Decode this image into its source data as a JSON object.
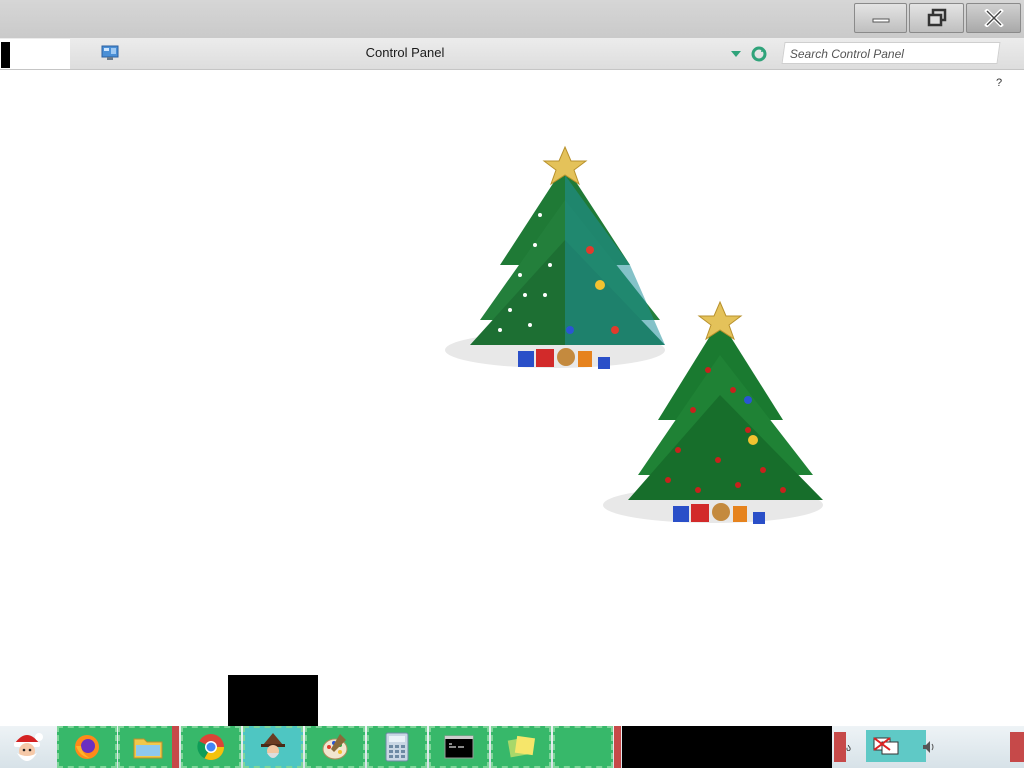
{
  "window": {
    "minimize_icon": "minimize-icon",
    "restore_icon": "restore-icon",
    "close_icon": "close-icon"
  },
  "address_bar": {
    "location_icon": "control-panel-icon",
    "breadcrumb": "Control Panel",
    "dropdown_icon": "chevron-down-icon",
    "refresh_icon": "refresh-icon",
    "search_placeholder": "Search Control Panel"
  },
  "help": {
    "label": "?"
  },
  "content": {
    "decorations": [
      "christmas-tree-blue-white",
      "christmas-tree-red"
    ]
  },
  "taskbar": {
    "start_icon": "santa-start-icon",
    "apps": [
      {
        "name": "firefox",
        "icon": "firefox-icon"
      },
      {
        "name": "file-explorer",
        "icon": "folder-icon"
      },
      {
        "name": "chrome",
        "icon": "chrome-icon"
      },
      {
        "name": "wizard",
        "icon": "wizard-icon"
      },
      {
        "name": "paint",
        "icon": "paint-palette-icon"
      },
      {
        "name": "calculator",
        "icon": "calculator-icon"
      },
      {
        "name": "command-prompt",
        "icon": "cmd-icon"
      },
      {
        "name": "sticky-notes",
        "icon": "notes-icon"
      },
      {
        "name": "empty-slot",
        "icon": ""
      }
    ],
    "tray": {
      "volume_icon": "volume-icon",
      "network_icon": "network-icon"
    }
  },
  "colors": {
    "taskbar_button": "#37b86a",
    "taskbar_separator": "#c64949",
    "tray_highlight": "#5fc9c6"
  }
}
